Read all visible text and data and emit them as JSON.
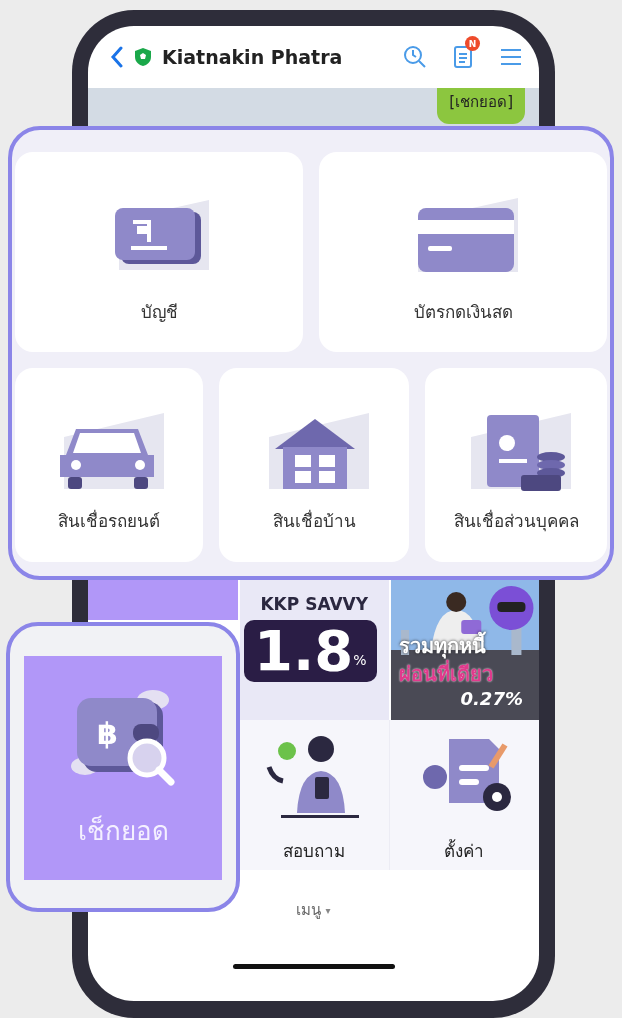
{
  "header": {
    "title": "Kiatnakin Phatra",
    "notification_badge": "N"
  },
  "check_balance_pill": "[เชกยอด]",
  "product_callout": {
    "items": [
      {
        "label": "บัญชี",
        "kind": "account"
      },
      {
        "label": "บัตรกดเงินสด",
        "kind": "card"
      },
      {
        "label": "สินเชื่อรถยนต์",
        "kind": "car"
      },
      {
        "label": "สินเชื่อบ้าน",
        "kind": "house"
      },
      {
        "label": "สินเชื่อส่วนบุคคล",
        "kind": "personal"
      }
    ]
  },
  "banners": [
    {
      "kind": "savings",
      "title": "KKP SAVVY",
      "rate": "1.8",
      "unit": "%"
    },
    {
      "kind": "debt",
      "headline": "รวมทุกหนี้",
      "subline": "ผ่อนที่เดียว",
      "rate": "0.27%"
    }
  ],
  "menu_tiles": [
    {
      "label": "สอบถาม",
      "kind": "support"
    },
    {
      "label": "ตั้งค่า",
      "kind": "settings"
    }
  ],
  "highlight_callout": {
    "label": "เช็กยอด",
    "kind": "balance",
    "symbol": "฿"
  },
  "bottom_bar": {
    "label": "เมนู",
    "caret": "▾"
  }
}
